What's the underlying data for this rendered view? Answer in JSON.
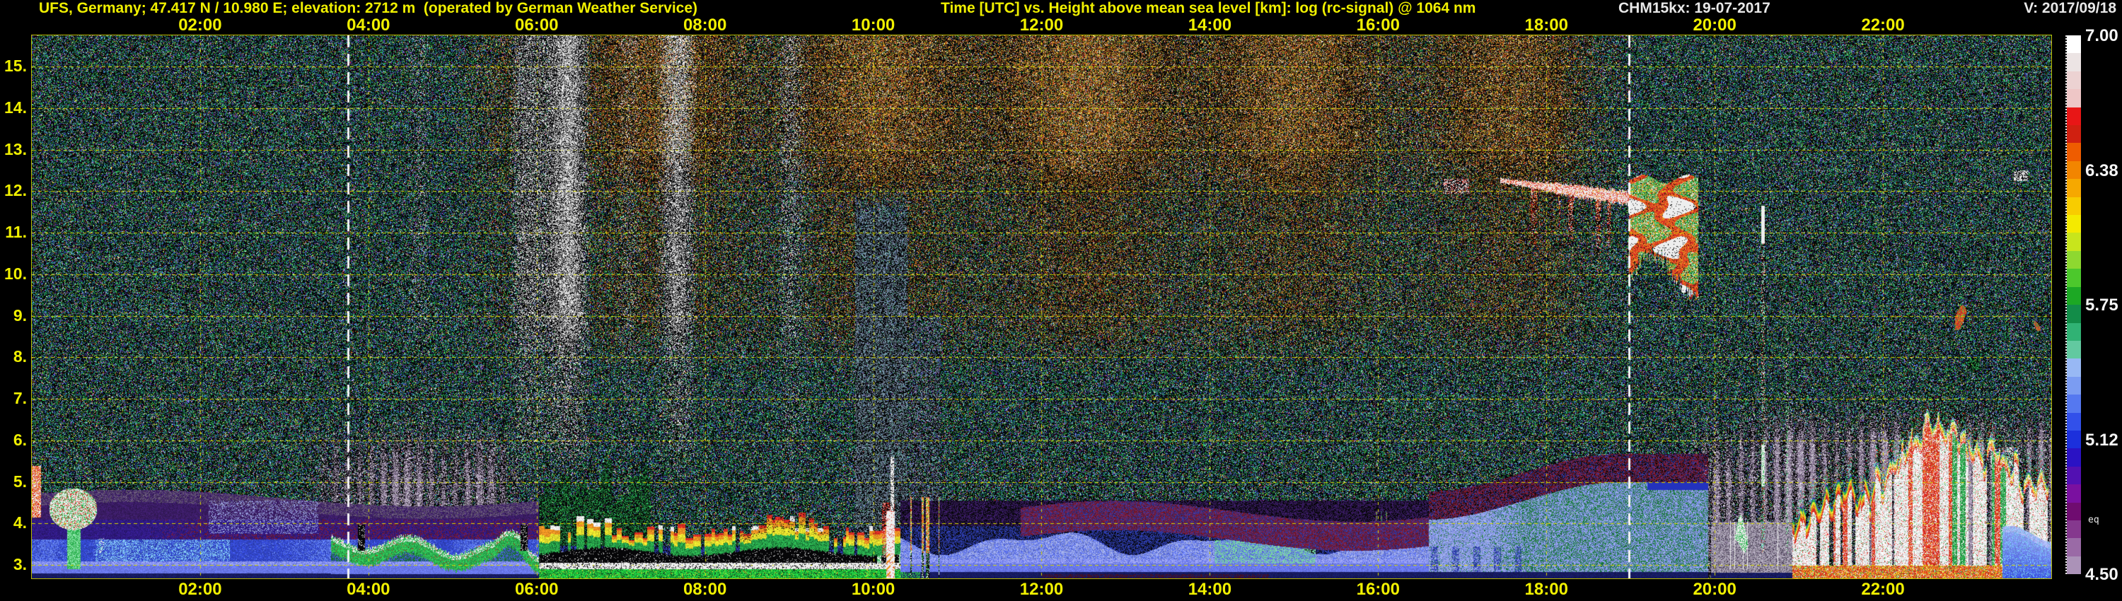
{
  "header": {
    "station": "UFS, Germany; 47.417 N / 10.980 E; elevation: 2712 m  (operated by German Weather Service)",
    "plot_title": "Time [UTC] vs. Height above mean sea level [km]: log (rc-signal) @ 1064 nm",
    "instrument_date": "CHM15kx: 19-07-2017",
    "version": "V: 2017/09/18"
  },
  "colors": {
    "background": "#000000",
    "axis_label": "#f0f000",
    "grid": "#d8d800",
    "header_text": "#f0f000",
    "instrument_text": "#e8e8e8",
    "sun_line": "#ffffff"
  },
  "x_axis": {
    "tick_hours": [
      2,
      4,
      6,
      8,
      10,
      12,
      14,
      16,
      18,
      20,
      22
    ],
    "tick_labels": [
      "02:00",
      "04:00",
      "06:00",
      "08:00",
      "10:00",
      "12:00",
      "14:00",
      "16:00",
      "18:00",
      "20:00",
      "22:00"
    ]
  },
  "y_axis": {
    "tick_values": [
      15,
      14,
      13,
      12,
      11,
      10,
      9,
      8,
      7,
      6,
      5,
      4,
      3
    ],
    "tick_labels": [
      "15.",
      "14.",
      "13.",
      "12.",
      "11.",
      "10.",
      "9.",
      "8.",
      "7.",
      "6.",
      "5.",
      "4.",
      "3."
    ]
  },
  "colorbar": {
    "tick_labels": [
      "7.00",
      "6.38",
      "5.75",
      "5.12",
      "4.50"
    ],
    "eq_label": "eq",
    "colors": [
      "#ffffff",
      "#ece4e4",
      "#ecd2d2",
      "#eec6c6",
      "#e81616",
      "#d02010",
      "#ee5c00",
      "#f28500",
      "#f6a800",
      "#f8cc00",
      "#f4ea00",
      "#c8e51c",
      "#8ed830",
      "#4cc82c",
      "#1ca824",
      "#128c48",
      "#30b274",
      "#62c9a0",
      "#98b8f4",
      "#7b9cf2",
      "#5578f0",
      "#3250ea",
      "#1c30dc",
      "#2a12c4",
      "#5210b2",
      "#7a10a0",
      "#6f0c70",
      "#85388e",
      "#9a6aa6",
      "#ab92b8"
    ]
  },
  "chart_data": {
    "type": "heatmap",
    "title": "Time [UTC] vs. Height above mean sea level [km]: log (rc-signal) @ 1064 nm",
    "x_label": "Time [UTC]",
    "y_label": "Height above mean sea level [km]",
    "x_range_hours": [
      0,
      24
    ],
    "y_range_km": [
      2.7,
      15.8
    ],
    "colorbar_range_log_signal": [
      4.5,
      7.0
    ],
    "wavelength_nm": 1064,
    "sun_lines_hours": [
      3.76,
      18.98
    ],
    "grid": {
      "x_step_hours": 2,
      "y_step_km": 1
    },
    "features": [
      {
        "name": "nocturnal_stratified_aerosol",
        "t": [
          0,
          5.9
        ],
        "h": [
          2.7,
          4.7
        ],
        "desc": "violet/purple aerosol layers; light-blue band 3.0-3.6 km; periwinkle band near 2.9 km; dark navy base"
      },
      {
        "name": "left_edge_cloud",
        "t": [
          0,
          0.8
        ],
        "h": [
          2.9,
          5.4
        ],
        "desc": "white/red echoes with green fall streak to 2.9 km"
      },
      {
        "name": "cyan_wisps",
        "t": [
          0.7,
          2.4
        ],
        "h": [
          3.0,
          3.6
        ],
        "desc": "bright cyan wisps inside light-blue band"
      },
      {
        "name": "predawn_green_layer",
        "t": [
          3.6,
          6.0
        ],
        "h": [
          3.0,
          3.8
        ],
        "desc": "bumpy green stratus with white caps, red flecks and black cells"
      },
      {
        "name": "morning_convective_plumes",
        "t": [
          6.0,
          10.3
        ],
        "h": [
          3.3,
          4.4
        ],
        "desc": "green-yellow-orange-red plumes, white caps after 07:30, strongest 08:30-09:30"
      },
      {
        "name": "saturated_black_band",
        "t": [
          6.0,
          10.3
        ],
        "h": [
          3.05,
          3.5
        ],
        "desc": "black saturated band above thin white line at ~3.0 km"
      },
      {
        "name": "surface_green_line",
        "t": [
          6.0,
          10.6
        ],
        "h": [
          2.7,
          2.9
        ],
        "desc": "bright green surface echo line"
      },
      {
        "name": "precip_shaft",
        "t": [
          9.8,
          10.2
        ],
        "h": [
          2.7,
          5.6
        ],
        "desc": "white precipitation shaft with orange diagonal fall streaks"
      },
      {
        "name": "secondary_shafts",
        "t": [
          10.4,
          10.8
        ],
        "h": [
          2.9,
          5.9
        ],
        "desc": "narrow orange/red shafts with black cells at base"
      },
      {
        "name": "midday_blue_aerosol",
        "t": [
          10.3,
          16.6
        ],
        "h": [
          2.8,
          4.0
        ],
        "desc": "silver-blue wisps over periwinkle band; pale green patch 14:00-15:15 at 3.1-3.6 km"
      },
      {
        "name": "maroon_layer",
        "t": [
          11.8,
          20.0
        ],
        "h": [
          3.6,
          5.6
        ],
        "desc": "dark-red speckle layer above boundary layer, rising in the evening"
      },
      {
        "name": "afternoon_haze_dome",
        "t": [
          16.6,
          19.9
        ],
        "h": [
          2.8,
          5.0
        ],
        "desc": "pale blue haze dome with green speckle, top rising to ~5 km"
      },
      {
        "name": "morning_noise_columns",
        "t": [
          4.4,
          9.4
        ],
        "h": [
          8.0,
          15.8
        ],
        "desc": "white/gray daylight noise columns at high altitude"
      },
      {
        "name": "day_noise_brown",
        "t": [
          5.0,
          19.0
        ],
        "h": [
          9.5,
          15.8
        ],
        "desc": "dense brown/orange daylight background noise"
      },
      {
        "name": "cirrus_band",
        "t": [
          17.5,
          19.0
        ],
        "h": [
          10.2,
          12.5
        ],
        "desc": "white/red cirrus band with descending virga"
      },
      {
        "name": "cirrus_blob",
        "t": [
          19.0,
          19.8
        ],
        "h": [
          9.6,
          12.3
        ],
        "desc": "thick red/white/orange/green cloud, sharp right edge"
      },
      {
        "name": "cirrus_wisp",
        "t": [
          16.8,
          17.1
        ],
        "h": [
          12.0,
          12.3
        ],
        "desc": "small white cirrus wisp"
      },
      {
        "name": "cloud_hooks",
        "t": [
          19.6,
          20.4
        ],
        "h": [
          3.4,
          4.1
        ],
        "desc": "small white cumulus hooks with green rims"
      },
      {
        "name": "silver_residual_layer",
        "t": [
          19.9,
          20.9
        ],
        "h": [
          2.8,
          4.1
        ],
        "desc": "silver-gray residual layer with thin white columns"
      },
      {
        "name": "evening_storm_clutter",
        "t": [
          20.9,
          23.95
        ],
        "h": [
          2.7,
          6.9
        ],
        "desc": "white/red/green towers, orange base band, rainbow tops, peak ~6.9 km at 22:55"
      },
      {
        "name": "low_blue_patch",
        "t": [
          23.4,
          24.0
        ],
        "h": [
          2.7,
          3.8
        ],
        "desc": "smooth periwinkle patch below clutter"
      },
      {
        "name": "broken_night_cells",
        "t": [
          22.9,
          24.0
        ],
        "h": [
          7.7,
          9.4
        ],
        "desc": "scattered red/green cloud cells"
      },
      {
        "name": "thin_echo_columns",
        "t": [
          20.2,
          23.95
        ],
        "h": [
          3.3,
          11.8
        ],
        "desc": "isolated narrow columns with white tops near 20:10, 20:30 and 23:50"
      },
      {
        "name": "noise_columns_above_precip",
        "t": [
          9.8,
          10.8
        ],
        "h": [
          4.5,
          12.2
        ],
        "desc": "steel-gray attenuated noise columns above precipitation"
      }
    ]
  }
}
